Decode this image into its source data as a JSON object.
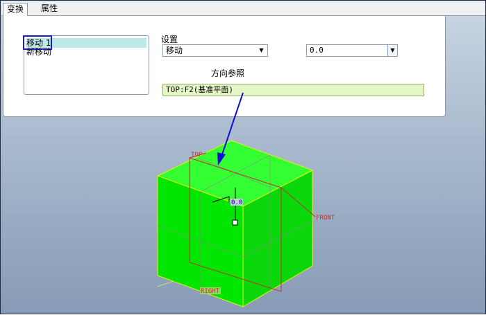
{
  "tabs": [
    {
      "label": "变换"
    },
    {
      "label": "属性"
    }
  ],
  "transform_list": {
    "items": [
      {
        "label": "移动 1",
        "selected": true
      },
      {
        "label": "新移动",
        "selected": false
      }
    ]
  },
  "settings": {
    "label": "设置",
    "type_value": "移动",
    "amount_value": "0.0"
  },
  "direction_reference": {
    "label": "方向参照",
    "value": "TOP:F2(基准平面)"
  },
  "viewport": {
    "datum_top": "TOP",
    "datum_front": "FRONT",
    "datum_right": "RIGHT",
    "drag_value": "0.0",
    "colors": {
      "solid": "#00e600",
      "edge": "#e8f400",
      "datum": "#c03030",
      "arrow": "#1010d0"
    }
  }
}
